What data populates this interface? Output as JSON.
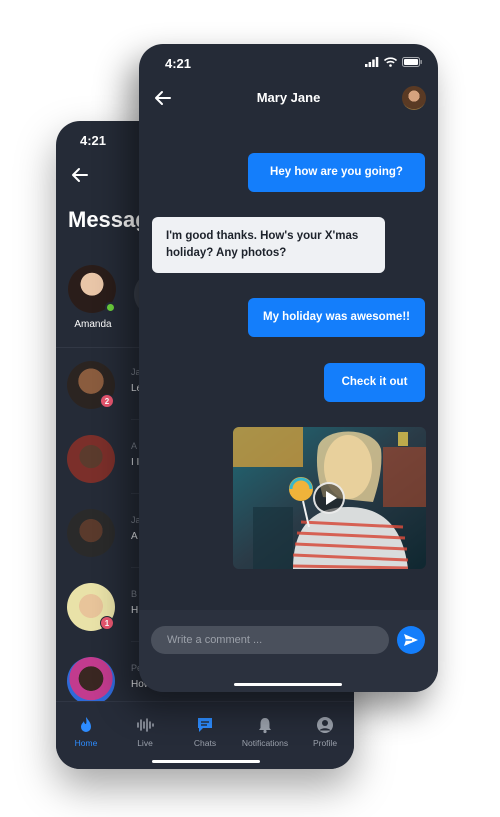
{
  "messages_screen": {
    "time": "4:21",
    "title": "Messages",
    "stories": [
      {
        "name": "Amanda",
        "online": true
      }
    ],
    "conversations": [
      {
        "name_fragment": "Ja",
        "message_fragment": "Le",
        "badge": "2",
        "avatar_color": "#6b4a34"
      },
      {
        "name_fragment": "A",
        "message_fragment": "I I",
        "badge": "",
        "avatar_color": "#3d2a22"
      },
      {
        "name_fragment": "Ja",
        "message_fragment": "A",
        "badge": "",
        "avatar_color": "#4a3128"
      },
      {
        "name_fragment": "B",
        "message_fragment": "H",
        "badge": "1",
        "avatar_color": "#e1c29a"
      },
      {
        "name_fragment": "Pe",
        "message_fragment": "How",
        "badge": "",
        "avatar_color": "#2f2320"
      }
    ],
    "tabs": [
      {
        "label": "Home",
        "icon": "flame-icon",
        "active": true
      },
      {
        "label": "Live",
        "icon": "waveform-icon",
        "active": false
      },
      {
        "label": "Chats",
        "icon": "chat-icon",
        "active": false
      },
      {
        "label": "Notifications",
        "icon": "bell-icon",
        "active": false
      },
      {
        "label": "Profile",
        "icon": "profile-icon",
        "active": false
      }
    ],
    "accent_color": "#2d8cff"
  },
  "chat_screen": {
    "time": "4:21",
    "contact_name": "Mary Jane",
    "messages": [
      {
        "direction": "out",
        "text": "Hey how are you going?"
      },
      {
        "direction": "in",
        "text": "I'm good thanks. How's your X'mas holiday? Any photos?"
      },
      {
        "direction": "out",
        "text": "My holiday was awesome!!"
      },
      {
        "direction": "out",
        "text": "Check it out"
      }
    ],
    "media": {
      "type": "video",
      "icon": "play-icon"
    },
    "composer": {
      "placeholder": "Write a comment ..."
    },
    "accent_color": "#147efb"
  }
}
